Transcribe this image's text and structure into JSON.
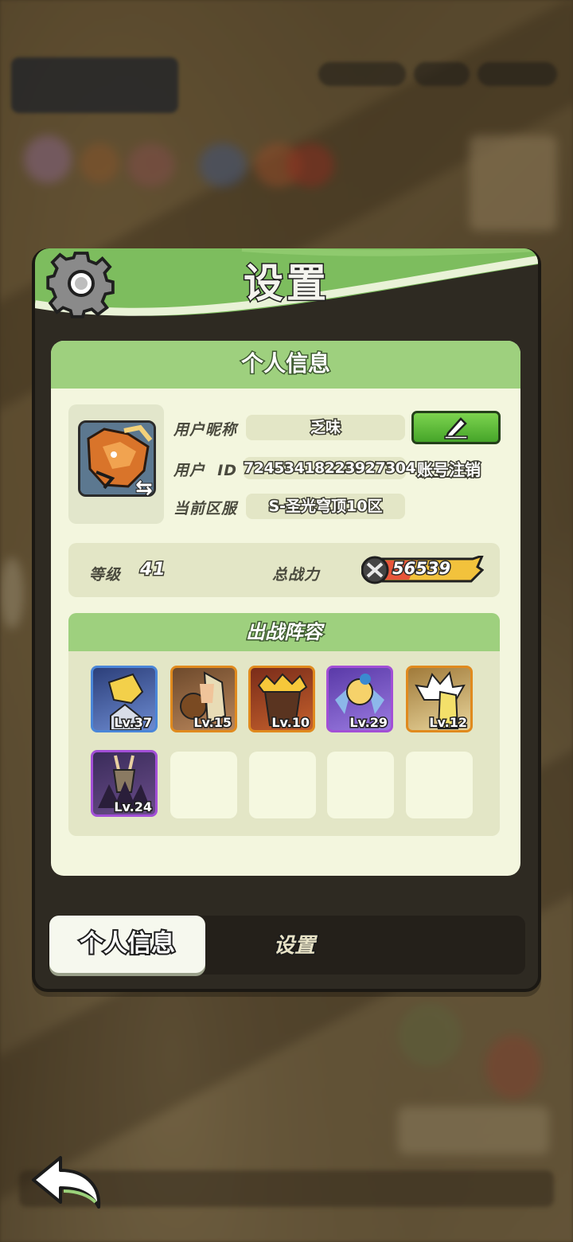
{
  "dialog": {
    "title": "设置"
  },
  "profile_card": {
    "header": "个人信息",
    "labels": {
      "nickname": "用户昵称",
      "user_id": "用户  ID",
      "server": "当前区服"
    },
    "nickname": "乏味",
    "user_id": "72453418223927304",
    "server": "S-圣光穹顶10区",
    "cancel_account_link": "账号注销"
  },
  "stats": {
    "level_label": "等级",
    "level": "41",
    "power_label": "总战力",
    "power": "56539"
  },
  "lineup": {
    "header": "出战阵容",
    "heroes": [
      {
        "level": "Lv.37",
        "frame": "#4a86d8"
      },
      {
        "level": "Lv.15",
        "frame": "#e08a1e"
      },
      {
        "level": "Lv.10",
        "frame": "#e08a1e"
      },
      {
        "level": "Lv.29",
        "frame": "#a24fd6"
      },
      {
        "level": "Lv.12",
        "frame": "#e08a1e"
      },
      {
        "level": "Lv.24",
        "frame": "#a24fd6"
      }
    ]
  },
  "tabs": {
    "active": "个人信息",
    "other": "设置"
  },
  "colors": {
    "header_green": "#9ed07e",
    "card_bg": "#f3f6de",
    "button_green": "#46a529"
  }
}
